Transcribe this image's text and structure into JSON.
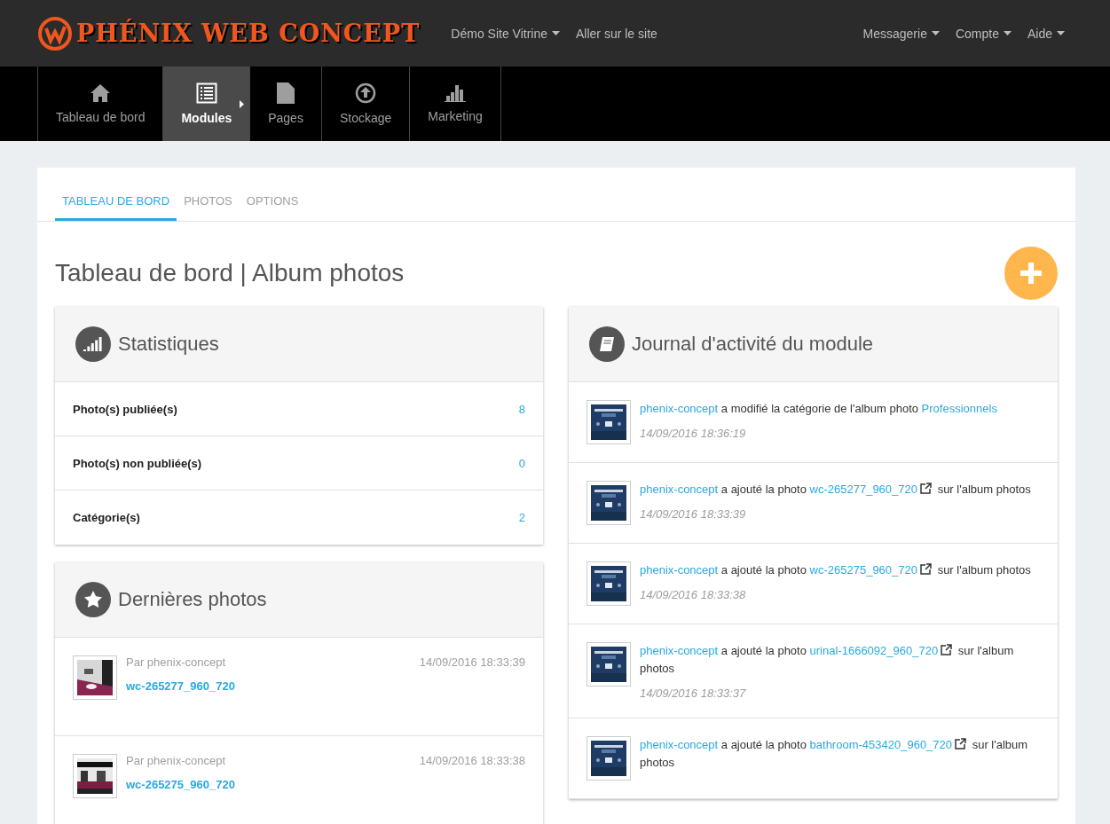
{
  "header": {
    "brand": "PHÉNIX WEB CONCEPT",
    "left_menu": [
      {
        "label": "Démo Site Vitrine",
        "dropdown": true
      },
      {
        "label": "Aller sur le site",
        "dropdown": false
      }
    ],
    "right_menu": [
      {
        "label": "Messagerie",
        "dropdown": true
      },
      {
        "label": "Compte",
        "dropdown": true
      },
      {
        "label": "Aide",
        "dropdown": true
      }
    ]
  },
  "main_nav": [
    {
      "kind": "home",
      "label": "Tableau de bord",
      "selected": false
    },
    {
      "kind": "list",
      "label": "Modules",
      "selected": true
    },
    {
      "kind": "file",
      "label": "Pages",
      "selected": false
    },
    {
      "kind": "upload",
      "label": "Stockage",
      "selected": false
    },
    {
      "kind": "chart",
      "label": "Marketing",
      "selected": false
    }
  ],
  "tabs": [
    {
      "label": "TABLEAU DE BORD",
      "selected": true
    },
    {
      "label": "PHOTOS",
      "selected": false
    },
    {
      "label": "OPTIONS",
      "selected": false
    }
  ],
  "page_title": "Tableau de bord | Album photos",
  "statistics": {
    "title": "Statistiques",
    "rows": [
      {
        "label": "Photo(s) publiée(s)",
        "value": "8"
      },
      {
        "label": "Photo(s) non publiée(s)",
        "value": "0"
      },
      {
        "label": "Catégorie(s)",
        "value": "2"
      }
    ]
  },
  "latest_photos": {
    "title": "Dernières photos",
    "items": [
      {
        "author": "Par phenix-concept",
        "date": "14/09/2016 18:33:39",
        "name": "wc-265277_960_720"
      },
      {
        "author": "Par phenix-concept",
        "date": "14/09/2016 18:33:38",
        "name": "wc-265275_960_720"
      }
    ]
  },
  "activity": {
    "title": "Journal d'activité du module",
    "entries": [
      {
        "parts": [
          {
            "kind": "link",
            "text": "phenix-concept"
          },
          {
            "kind": "text",
            "text": "a modifié la catégorie de l'album photo"
          },
          {
            "kind": "link",
            "text": "Professionnels"
          }
        ],
        "time": "14/09/2016 18:36:19"
      },
      {
        "parts": [
          {
            "kind": "link",
            "text": "phenix-concept"
          },
          {
            "kind": "text",
            "text": "a ajouté la photo"
          },
          {
            "kind": "extlink",
            "text": "wc-265277_960_720"
          },
          {
            "kind": "text",
            "text": "sur l'album photos"
          }
        ],
        "time": "14/09/2016 18:33:39"
      },
      {
        "parts": [
          {
            "kind": "link",
            "text": "phenix-concept"
          },
          {
            "kind": "text",
            "text": "a ajouté la photo"
          },
          {
            "kind": "extlink",
            "text": "wc-265275_960_720"
          },
          {
            "kind": "text",
            "text": "sur l'album photos"
          }
        ],
        "time": "14/09/2016 18:33:38"
      },
      {
        "parts": [
          {
            "kind": "link",
            "text": "phenix-concept"
          },
          {
            "kind": "text",
            "text": "a ajouté la photo"
          },
          {
            "kind": "extlink",
            "text": "urinal-1666092_960_720"
          },
          {
            "kind": "text",
            "text": "sur l'album photos"
          }
        ],
        "time": "14/09/2016 18:33:37"
      },
      {
        "parts": [
          {
            "kind": "link",
            "text": "phenix-concept"
          },
          {
            "kind": "text",
            "text": "a ajouté la photo"
          },
          {
            "kind": "extlink",
            "text": "bathroom-453420_960_720"
          },
          {
            "kind": "text",
            "text": "sur l'album photos"
          }
        ]
      }
    ]
  }
}
